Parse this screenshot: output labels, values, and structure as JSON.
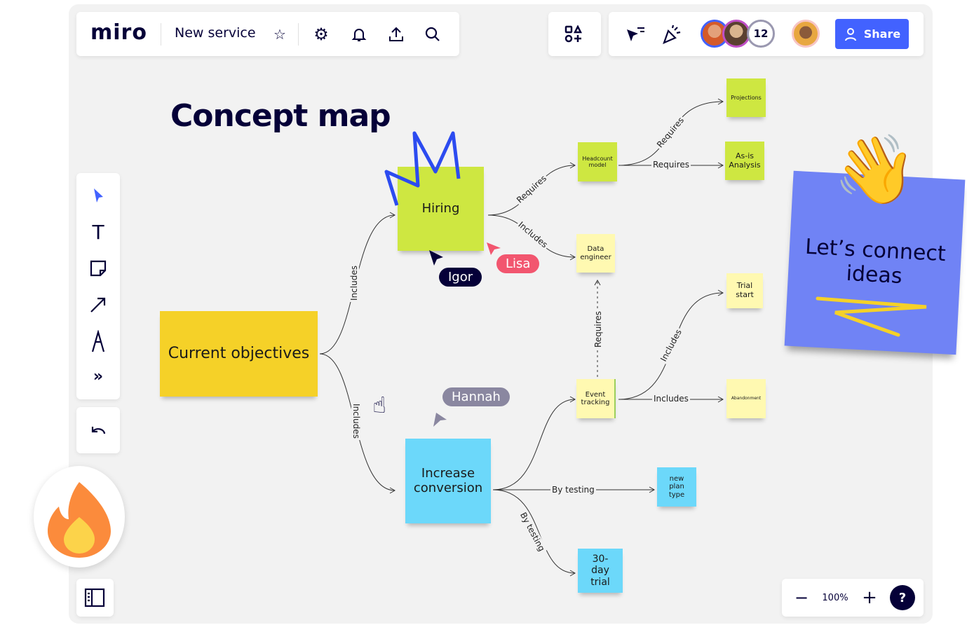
{
  "topbar": {
    "logo": "miro",
    "board_name": "New service",
    "collaborator_count": "12",
    "share_label": "Share",
    "icons": [
      "star-icon",
      "gear-icon",
      "bell-icon",
      "upload-icon",
      "search-icon",
      "shapes-icon",
      "cursor-filter-icon",
      "party-popper-icon",
      "user-icon"
    ]
  },
  "title": "Concept map",
  "toolbar": {
    "tools": [
      "select-icon",
      "text-icon",
      "sticky-note-icon",
      "arrow-icon",
      "pen-icon",
      "more-icon"
    ],
    "more_label": "»",
    "undo": "undo-icon",
    "panel": "panel-icon"
  },
  "nodes": {
    "current_objectives": "Current objectives",
    "hiring": "Hiring",
    "increase_conversion": "Increase conversion",
    "headcount_model": "Headcount model",
    "projections": "Projections",
    "as_is_analysis": "As-is Analysis",
    "data_engineer": "Data engineer",
    "trial_start": "Trial start",
    "event_tracking": "Event tracking",
    "abandonment": "Abandonment",
    "new_plan_type": "new plan type",
    "trial_30_day": "30-day trial"
  },
  "edges": {
    "co_hiring": "Includes",
    "co_ic": "Includes",
    "hiring_headcount": "Requires",
    "hiring_data": "Includes",
    "headcount_proj": "Requires",
    "headcount_asis": "Requires",
    "event_data": "Requires",
    "event_trial": "Includes",
    "event_abandon": "Includes",
    "ic_newplan": "By testing",
    "ic_30day": "By testing"
  },
  "cursors": {
    "igor": "Igor",
    "lisa": "Lisa",
    "hannah": "Hannah"
  },
  "sticker": {
    "text": "Let’s connect ideas"
  },
  "zoom": {
    "level": "100%",
    "minus": "−",
    "plus": "+",
    "help": "?"
  },
  "colors": {
    "accent": "#4262ff",
    "lime": "#cee741",
    "yellow": "#f5d128",
    "light_yellow": "#fff9b1",
    "blue": "#6cd8fa",
    "purple": "#7083f5",
    "lisa": "#f2566f",
    "hannah": "#8a87a0",
    "igor": "#050038"
  }
}
